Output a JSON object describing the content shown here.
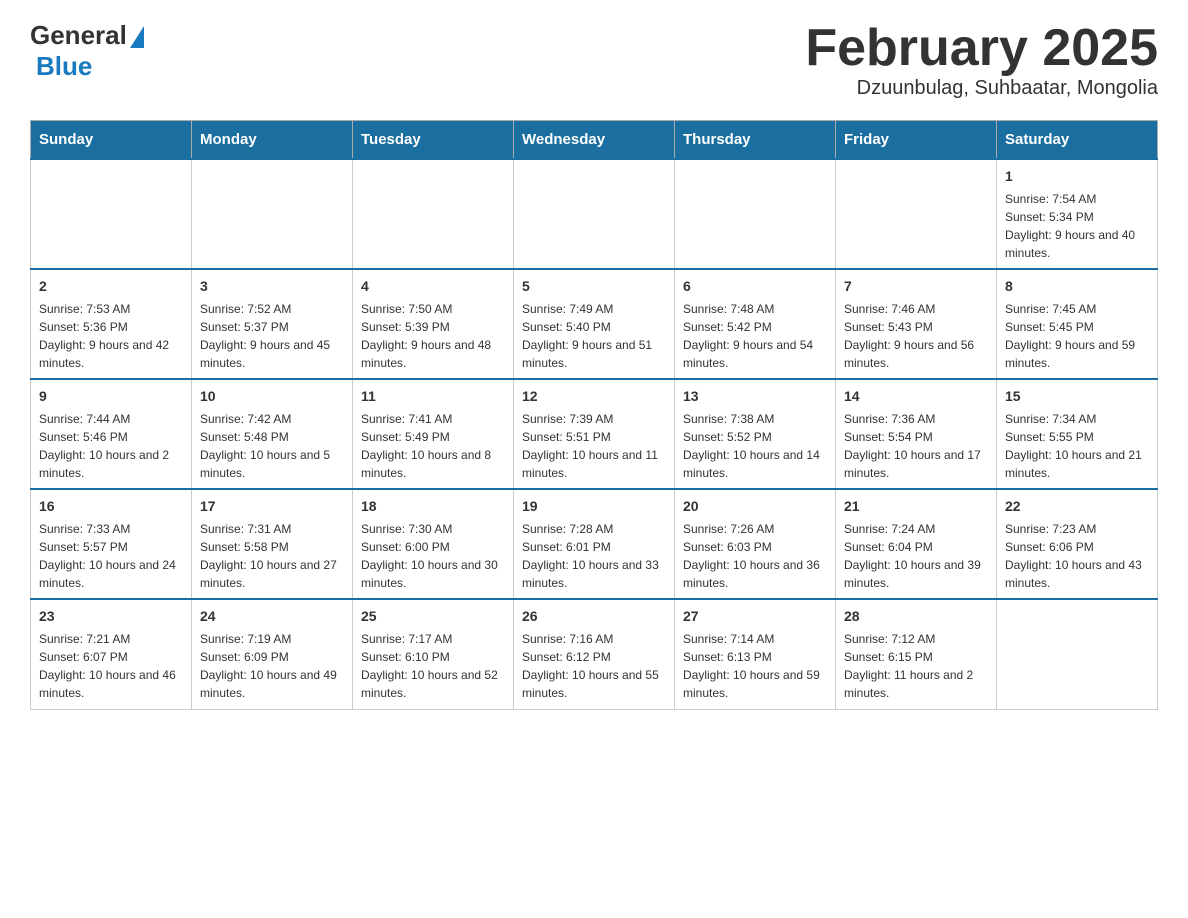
{
  "header": {
    "logo_general": "General",
    "logo_blue": "Blue",
    "title": "February 2025",
    "subtitle": "Dzuunbulag, Suhbaatar, Mongolia"
  },
  "calendar": {
    "days_of_week": [
      "Sunday",
      "Monday",
      "Tuesday",
      "Wednesday",
      "Thursday",
      "Friday",
      "Saturday"
    ],
    "weeks": [
      [
        {
          "day": "",
          "sunrise": "",
          "sunset": "",
          "daylight": ""
        },
        {
          "day": "",
          "sunrise": "",
          "sunset": "",
          "daylight": ""
        },
        {
          "day": "",
          "sunrise": "",
          "sunset": "",
          "daylight": ""
        },
        {
          "day": "",
          "sunrise": "",
          "sunset": "",
          "daylight": ""
        },
        {
          "day": "",
          "sunrise": "",
          "sunset": "",
          "daylight": ""
        },
        {
          "day": "",
          "sunrise": "",
          "sunset": "",
          "daylight": ""
        },
        {
          "day": "1",
          "sunrise": "Sunrise: 7:54 AM",
          "sunset": "Sunset: 5:34 PM",
          "daylight": "Daylight: 9 hours and 40 minutes."
        }
      ],
      [
        {
          "day": "2",
          "sunrise": "Sunrise: 7:53 AM",
          "sunset": "Sunset: 5:36 PM",
          "daylight": "Daylight: 9 hours and 42 minutes."
        },
        {
          "day": "3",
          "sunrise": "Sunrise: 7:52 AM",
          "sunset": "Sunset: 5:37 PM",
          "daylight": "Daylight: 9 hours and 45 minutes."
        },
        {
          "day": "4",
          "sunrise": "Sunrise: 7:50 AM",
          "sunset": "Sunset: 5:39 PM",
          "daylight": "Daylight: 9 hours and 48 minutes."
        },
        {
          "day": "5",
          "sunrise": "Sunrise: 7:49 AM",
          "sunset": "Sunset: 5:40 PM",
          "daylight": "Daylight: 9 hours and 51 minutes."
        },
        {
          "day": "6",
          "sunrise": "Sunrise: 7:48 AM",
          "sunset": "Sunset: 5:42 PM",
          "daylight": "Daylight: 9 hours and 54 minutes."
        },
        {
          "day": "7",
          "sunrise": "Sunrise: 7:46 AM",
          "sunset": "Sunset: 5:43 PM",
          "daylight": "Daylight: 9 hours and 56 minutes."
        },
        {
          "day": "8",
          "sunrise": "Sunrise: 7:45 AM",
          "sunset": "Sunset: 5:45 PM",
          "daylight": "Daylight: 9 hours and 59 minutes."
        }
      ],
      [
        {
          "day": "9",
          "sunrise": "Sunrise: 7:44 AM",
          "sunset": "Sunset: 5:46 PM",
          "daylight": "Daylight: 10 hours and 2 minutes."
        },
        {
          "day": "10",
          "sunrise": "Sunrise: 7:42 AM",
          "sunset": "Sunset: 5:48 PM",
          "daylight": "Daylight: 10 hours and 5 minutes."
        },
        {
          "day": "11",
          "sunrise": "Sunrise: 7:41 AM",
          "sunset": "Sunset: 5:49 PM",
          "daylight": "Daylight: 10 hours and 8 minutes."
        },
        {
          "day": "12",
          "sunrise": "Sunrise: 7:39 AM",
          "sunset": "Sunset: 5:51 PM",
          "daylight": "Daylight: 10 hours and 11 minutes."
        },
        {
          "day": "13",
          "sunrise": "Sunrise: 7:38 AM",
          "sunset": "Sunset: 5:52 PM",
          "daylight": "Daylight: 10 hours and 14 minutes."
        },
        {
          "day": "14",
          "sunrise": "Sunrise: 7:36 AM",
          "sunset": "Sunset: 5:54 PM",
          "daylight": "Daylight: 10 hours and 17 minutes."
        },
        {
          "day": "15",
          "sunrise": "Sunrise: 7:34 AM",
          "sunset": "Sunset: 5:55 PM",
          "daylight": "Daylight: 10 hours and 21 minutes."
        }
      ],
      [
        {
          "day": "16",
          "sunrise": "Sunrise: 7:33 AM",
          "sunset": "Sunset: 5:57 PM",
          "daylight": "Daylight: 10 hours and 24 minutes."
        },
        {
          "day": "17",
          "sunrise": "Sunrise: 7:31 AM",
          "sunset": "Sunset: 5:58 PM",
          "daylight": "Daylight: 10 hours and 27 minutes."
        },
        {
          "day": "18",
          "sunrise": "Sunrise: 7:30 AM",
          "sunset": "Sunset: 6:00 PM",
          "daylight": "Daylight: 10 hours and 30 minutes."
        },
        {
          "day": "19",
          "sunrise": "Sunrise: 7:28 AM",
          "sunset": "Sunset: 6:01 PM",
          "daylight": "Daylight: 10 hours and 33 minutes."
        },
        {
          "day": "20",
          "sunrise": "Sunrise: 7:26 AM",
          "sunset": "Sunset: 6:03 PM",
          "daylight": "Daylight: 10 hours and 36 minutes."
        },
        {
          "day": "21",
          "sunrise": "Sunrise: 7:24 AM",
          "sunset": "Sunset: 6:04 PM",
          "daylight": "Daylight: 10 hours and 39 minutes."
        },
        {
          "day": "22",
          "sunrise": "Sunrise: 7:23 AM",
          "sunset": "Sunset: 6:06 PM",
          "daylight": "Daylight: 10 hours and 43 minutes."
        }
      ],
      [
        {
          "day": "23",
          "sunrise": "Sunrise: 7:21 AM",
          "sunset": "Sunset: 6:07 PM",
          "daylight": "Daylight: 10 hours and 46 minutes."
        },
        {
          "day": "24",
          "sunrise": "Sunrise: 7:19 AM",
          "sunset": "Sunset: 6:09 PM",
          "daylight": "Daylight: 10 hours and 49 minutes."
        },
        {
          "day": "25",
          "sunrise": "Sunrise: 7:17 AM",
          "sunset": "Sunset: 6:10 PM",
          "daylight": "Daylight: 10 hours and 52 minutes."
        },
        {
          "day": "26",
          "sunrise": "Sunrise: 7:16 AM",
          "sunset": "Sunset: 6:12 PM",
          "daylight": "Daylight: 10 hours and 55 minutes."
        },
        {
          "day": "27",
          "sunrise": "Sunrise: 7:14 AM",
          "sunset": "Sunset: 6:13 PM",
          "daylight": "Daylight: 10 hours and 59 minutes."
        },
        {
          "day": "28",
          "sunrise": "Sunrise: 7:12 AM",
          "sunset": "Sunset: 6:15 PM",
          "daylight": "Daylight: 11 hours and 2 minutes."
        },
        {
          "day": "",
          "sunrise": "",
          "sunset": "",
          "daylight": ""
        }
      ]
    ]
  }
}
